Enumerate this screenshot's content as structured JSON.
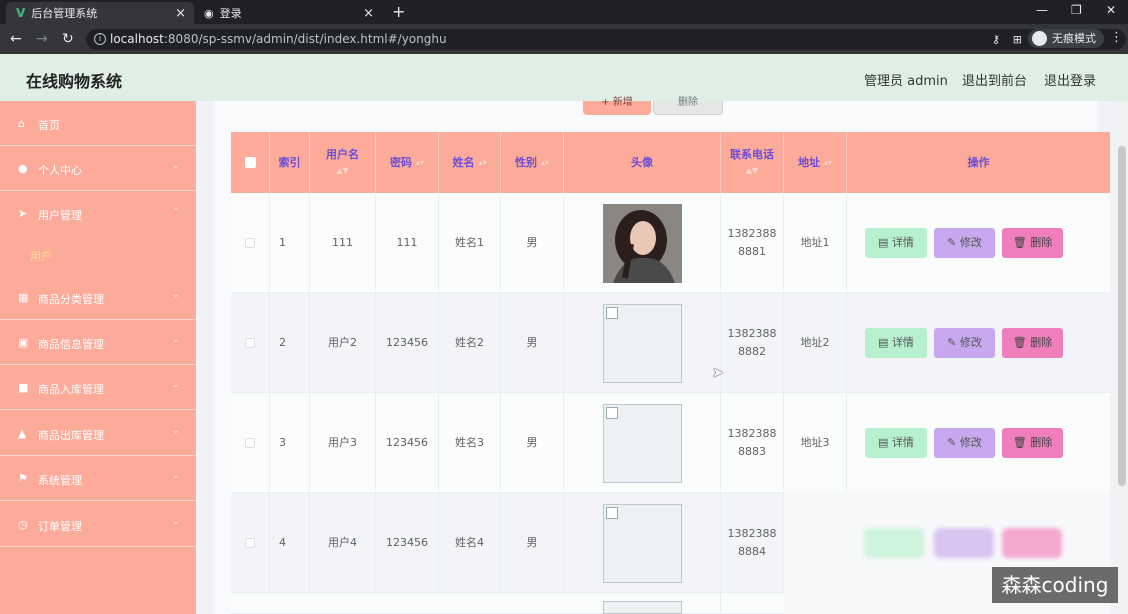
{
  "browser": {
    "tabs": [
      {
        "title": "后台管理系统",
        "close": "×"
      },
      {
        "title": "登录",
        "close": "×"
      }
    ],
    "new_tab": "+",
    "window_controls": [
      "—",
      "❐",
      "✕"
    ],
    "url_host": "localhost",
    "url_rest": ":8080/sp-ssmv/admin/dist/index.html#/yonghu",
    "incognito_label": "无痕模式"
  },
  "header": {
    "title": "在线购物系统",
    "admin_label": "管理员 admin",
    "front_link": "退出到前台",
    "logout_link": "退出登录"
  },
  "sidebar": {
    "items": [
      {
        "label": "首页",
        "icon": "home-icon",
        "glyph": "⌂"
      },
      {
        "label": "个人中心",
        "icon": "user-icon",
        "glyph": "●"
      },
      {
        "label": "用户管理",
        "icon": "send-icon",
        "glyph": "➤"
      },
      {
        "label": "商品分类管理",
        "icon": "grid-icon",
        "glyph": "▦"
      },
      {
        "label": "商品信息管理",
        "icon": "doc-icon",
        "glyph": "▣"
      },
      {
        "label": "商品入库管理",
        "icon": "camera-icon",
        "glyph": "■"
      },
      {
        "label": "商品出库管理",
        "icon": "stamp-icon",
        "glyph": "▲"
      },
      {
        "label": "系统管理",
        "icon": "flag-icon",
        "glyph": "⚑"
      },
      {
        "label": "订单管理",
        "icon": "clock-icon",
        "glyph": "◷"
      }
    ],
    "active_sub": "用户"
  },
  "toolbar": {
    "add_label": "+ 新增",
    "delete_label": "删除"
  },
  "table": {
    "headers": {
      "index": "索引",
      "username": "用户名",
      "password": "密码",
      "name": "姓名",
      "gender": "性别",
      "avatar": "头像",
      "phone": "联系电话",
      "address": "地址",
      "actions": "操作"
    },
    "rows": [
      {
        "index": "1",
        "username": "111",
        "password": "111",
        "name": "姓名1",
        "gender": "男",
        "phone": "13823888881",
        "address": "地址1"
      },
      {
        "index": "2",
        "username": "用户2",
        "password": "123456",
        "name": "姓名2",
        "gender": "男",
        "phone": "13823888882",
        "address": "地址2"
      },
      {
        "index": "3",
        "username": "用户3",
        "password": "123456",
        "name": "姓名3",
        "gender": "男",
        "phone": "13823888883",
        "address": "地址3"
      },
      {
        "index": "4",
        "username": "用户4",
        "password": "123456",
        "name": "姓名4",
        "gender": "男",
        "phone": "13823888884",
        "address": ""
      }
    ],
    "btn_detail": "详情",
    "btn_edit": "修改",
    "btn_delete": "删除"
  },
  "colors": {
    "sidebar": "#fcaa9a",
    "header": "#dfefe6",
    "th_text": "#6b4fd6",
    "detail": "#b7f0cf",
    "edit": "#c7a8ee",
    "delete": "#f07dbc"
  },
  "watermark": "森森coding"
}
